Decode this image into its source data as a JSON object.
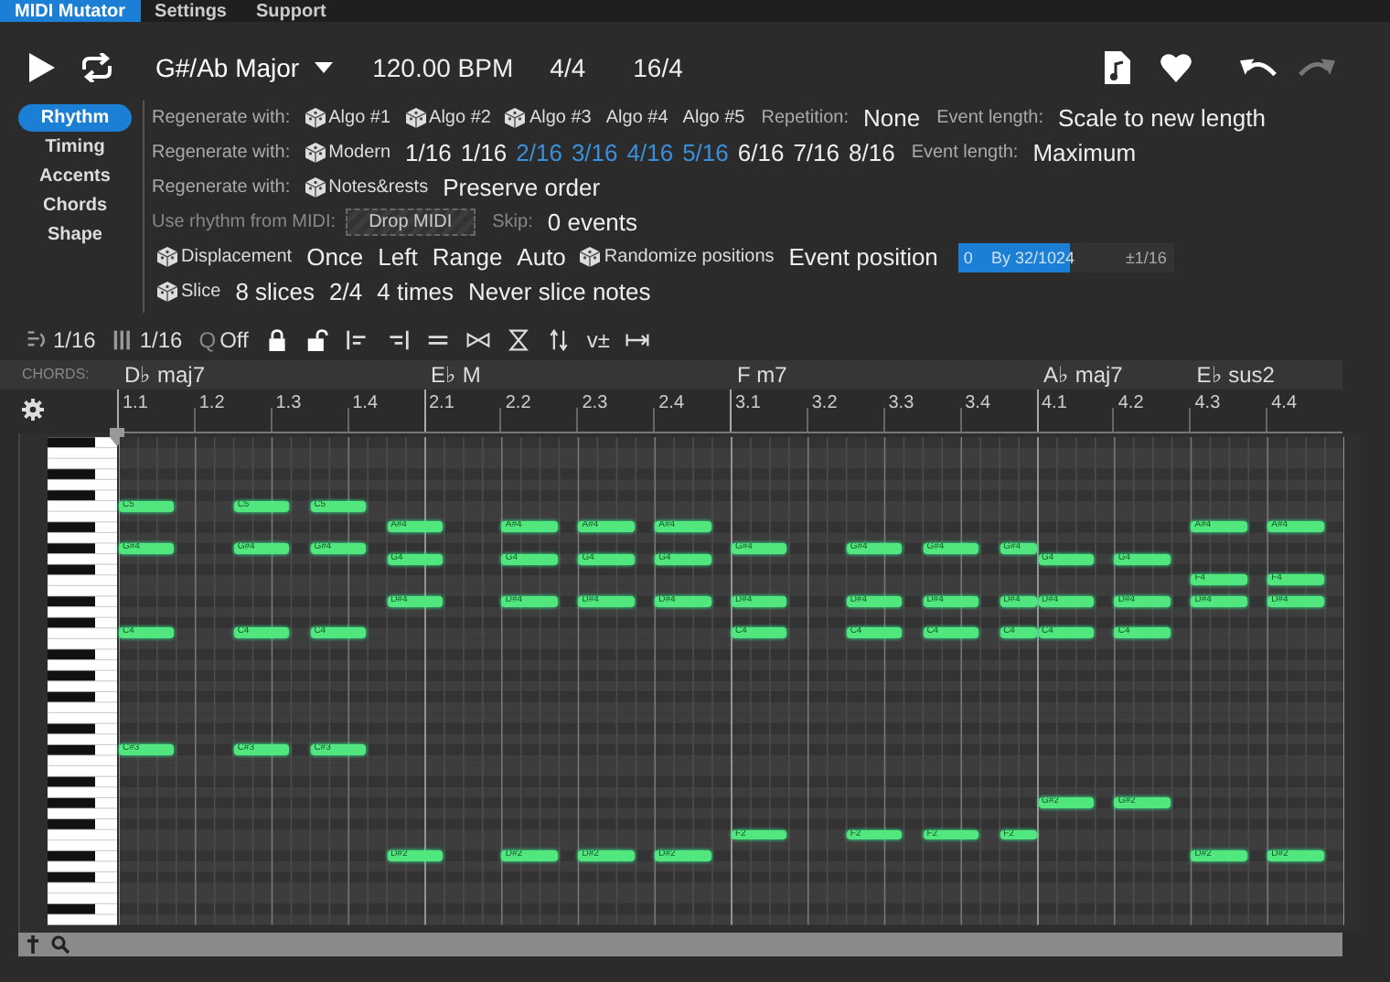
{
  "menu": [
    {
      "label": "MIDI Mutator",
      "selected": true
    },
    {
      "label": "Settings",
      "selected": false
    },
    {
      "label": "Support",
      "selected": false
    }
  ],
  "transport": {
    "key": "G#/Ab Major",
    "tempo": "120.00 BPM",
    "time_signature": "4/4",
    "length": "16/4",
    "redo_disabled": true
  },
  "nav": [
    {
      "label": "Rhythm",
      "selected": true
    },
    {
      "label": "Timing",
      "selected": false
    },
    {
      "label": "Accents",
      "selected": false
    },
    {
      "label": "Chords",
      "selected": false
    },
    {
      "label": "Shape",
      "selected": false
    }
  ],
  "options": [
    {
      "items": [
        {
          "kind": "label",
          "text": "Regenerate with:"
        },
        {
          "kind": "dice",
          "text": "Algo #1"
        },
        {
          "kind": "dice",
          "text": "Algo #2"
        },
        {
          "kind": "dice",
          "text": "Algo #3"
        },
        {
          "kind": "plain",
          "text": "Algo #4"
        },
        {
          "kind": "plain",
          "text": "Algo #5"
        },
        {
          "kind": "label",
          "text": "Repetition:"
        },
        {
          "kind": "value",
          "text": "None"
        },
        {
          "kind": "label",
          "text": "Event length:"
        },
        {
          "kind": "value",
          "text": "Scale to new length"
        }
      ]
    },
    {
      "items": [
        {
          "kind": "label",
          "text": "Regenerate with:"
        },
        {
          "kind": "dice",
          "text": "Modern"
        },
        {
          "kind": "value",
          "text": "1/16"
        },
        {
          "kind": "step",
          "text": "1/16",
          "selected": false
        },
        {
          "kind": "step",
          "text": "2/16",
          "selected": true
        },
        {
          "kind": "step",
          "text": "3/16",
          "selected": true
        },
        {
          "kind": "step",
          "text": "4/16",
          "selected": true
        },
        {
          "kind": "step",
          "text": "5/16",
          "selected": true
        },
        {
          "kind": "step",
          "text": "6/16",
          "selected": false
        },
        {
          "kind": "step",
          "text": "7/16",
          "selected": false
        },
        {
          "kind": "step",
          "text": "8/16",
          "selected": false
        },
        {
          "kind": "label",
          "text": "Event length:"
        },
        {
          "kind": "value",
          "text": "Maximum"
        }
      ]
    },
    {
      "items": [
        {
          "kind": "label",
          "text": "Regenerate with:"
        },
        {
          "kind": "dice",
          "text": "Notes&rests"
        },
        {
          "kind": "value",
          "text": "Preserve order"
        }
      ]
    },
    {
      "items": [
        {
          "kind": "label",
          "text": "Use rhythm from MIDI:"
        },
        {
          "kind": "drop",
          "text": "Drop MIDI"
        },
        {
          "kind": "label",
          "text": "Skip:"
        },
        {
          "kind": "value",
          "text": "0 events"
        }
      ]
    },
    {
      "items": [
        {
          "kind": "dice",
          "text": "Displacement"
        },
        {
          "kind": "value",
          "text": "Once"
        },
        {
          "kind": "value",
          "text": "Left"
        },
        {
          "kind": "value",
          "text": "Range"
        },
        {
          "kind": "value",
          "text": "Auto"
        },
        {
          "kind": "dice",
          "text": "Randomize positions"
        },
        {
          "kind": "value",
          "text": "Event position"
        },
        {
          "kind": "slider",
          "min": "0",
          "text": "By 32/1024",
          "max": "±1/16",
          "level": 0.52
        }
      ]
    },
    {
      "items": [
        {
          "kind": "dice",
          "text": "Slice"
        },
        {
          "kind": "value",
          "text": "8 slices"
        },
        {
          "kind": "value",
          "text": "2/4"
        },
        {
          "kind": "value",
          "text": "4 times"
        },
        {
          "kind": "value",
          "text": "Never slice notes"
        }
      ]
    }
  ],
  "tools": [
    {
      "kind": "snap",
      "text": "1/16"
    },
    {
      "kind": "grid",
      "text": "1/16"
    },
    {
      "kind": "quantize",
      "icon": "Q",
      "text": "Off"
    },
    {
      "kind": "lock"
    },
    {
      "kind": "unlock"
    },
    {
      "kind": "align-left"
    },
    {
      "kind": "align-right"
    },
    {
      "kind": "equal"
    },
    {
      "kind": "bowtie"
    },
    {
      "kind": "hourglass"
    },
    {
      "kind": "updown"
    },
    {
      "kind": "velocity",
      "text": "v±"
    },
    {
      "kind": "range"
    }
  ],
  "chords_label": "CHORDS:",
  "chords": [
    {
      "name": "D♭ maj7"
    },
    {
      "name": "E♭ M"
    },
    {
      "name": "F m7"
    },
    {
      "name": "A♭ maj7"
    },
    {
      "name": "E♭ sus2"
    }
  ],
  "ruler": [
    "1.1",
    "1.2",
    "1.3",
    "1.4",
    "2.1",
    "2.2",
    "2.3",
    "2.4",
    "3.1",
    "3.2",
    "3.3",
    "3.4",
    "4.1",
    "4.2",
    "4.3",
    "4.4"
  ],
  "note_columns": [
    {
      "pitches": [
        "C5",
        "G#4",
        "C4",
        "C#3"
      ],
      "short": false
    },
    {
      "pitches": [
        "C5",
        "G#4",
        "C4",
        "C#3"
      ],
      "short": false
    },
    {
      "pitches": [
        "C5",
        "G#4",
        "C4",
        "C#3"
      ],
      "short": false
    },
    {
      "pitches": [
        "A#4",
        "G4",
        "D#4",
        "D#2"
      ],
      "short": false
    },
    {
      "pitches": [
        "A#4",
        "G4",
        "D#4",
        "D#2"
      ],
      "short": false
    },
    {
      "pitches": [
        "A#4",
        "G4",
        "D#4",
        "D#2"
      ],
      "short": false
    },
    {
      "pitches": [
        "A#4",
        "G4",
        "D#4",
        "D#2"
      ],
      "short": false
    },
    {
      "pitches": [
        "G#4",
        "D#4",
        "C4",
        "F2"
      ],
      "short": false
    },
    {
      "pitches": [
        "G#4",
        "D#4",
        "C4",
        "F2"
      ],
      "short": false
    },
    {
      "pitches": [
        "G#4",
        "D#4",
        "C4",
        "F2"
      ],
      "short": false
    },
    {
      "pitches": [
        "G#4",
        "D#4",
        "C4",
        "F2"
      ],
      "short": true
    },
    {
      "pitches": [
        "G4",
        "D#4",
        "C4",
        "G#2"
      ],
      "short": false
    },
    {
      "pitches": [
        "G4",
        "D#4",
        "C4",
        "G#2"
      ],
      "short": false
    },
    {
      "pitches": [
        "A#4",
        "F4",
        "D#4",
        "D#2"
      ],
      "short": false
    },
    {
      "pitches": [
        "A#4",
        "F4",
        "D#4",
        "D#2"
      ],
      "short": false
    }
  ]
}
